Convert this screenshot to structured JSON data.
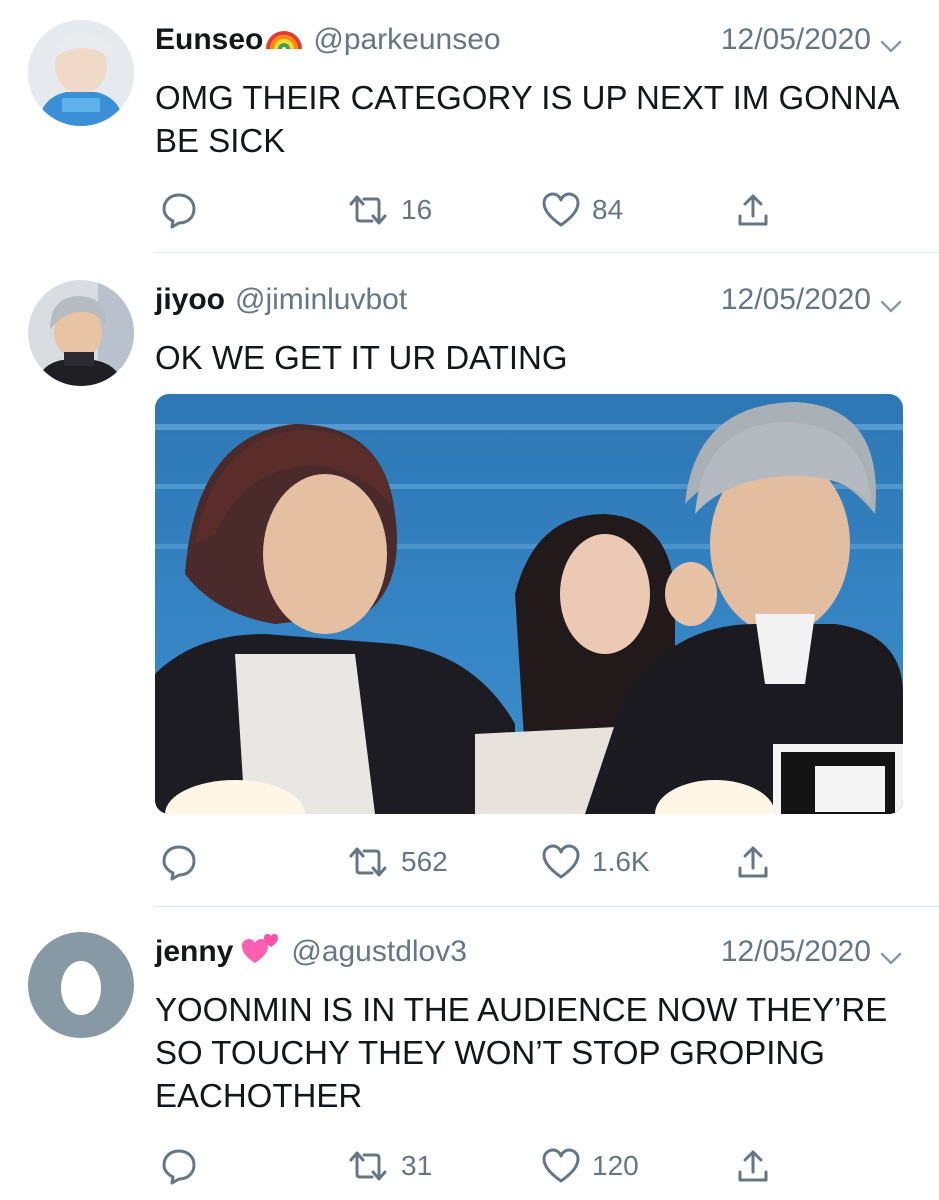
{
  "tweets": [
    {
      "name": "Eunseo",
      "name_emoji": "rainbow-emoji",
      "handle": "@parkeunseo",
      "date": "12/05/2020",
      "text": "OMG THEIR CATEGORY IS UP NEXT IM GONNA BE SICK",
      "retweets": "16",
      "likes": "84",
      "avatar": "profile-photo"
    },
    {
      "name": "jiyoo",
      "handle": "@jiminluvbot",
      "date": "12/05/2020",
      "text": "OK WE GET IT UR DATING",
      "retweets": "562",
      "likes": "1.6K",
      "avatar": "profile-photo",
      "has_media": true
    },
    {
      "name": "jenny",
      "name_emoji": "two-hearts-emoji",
      "handle": "@agustdlov3",
      "date": "12/05/2020",
      "text": "YOONMIN IS IN THE AUDIENCE NOW THEY’RE SO TOUCHY THEY WON’T STOP GROPING EACHOTHER",
      "retweets": "31",
      "likes": "120",
      "avatar": "default-egg-avatar"
    }
  ],
  "icons": {
    "reply": "reply-icon",
    "retweet": "retweet-icon",
    "like": "heart-icon",
    "share": "share-icon",
    "caret": "chevron-down-icon"
  },
  "colors": {
    "text": "#14171a",
    "secondary": "#657786",
    "divider": "#e1e8ed",
    "default_avatar_bg": "#8899a6"
  }
}
